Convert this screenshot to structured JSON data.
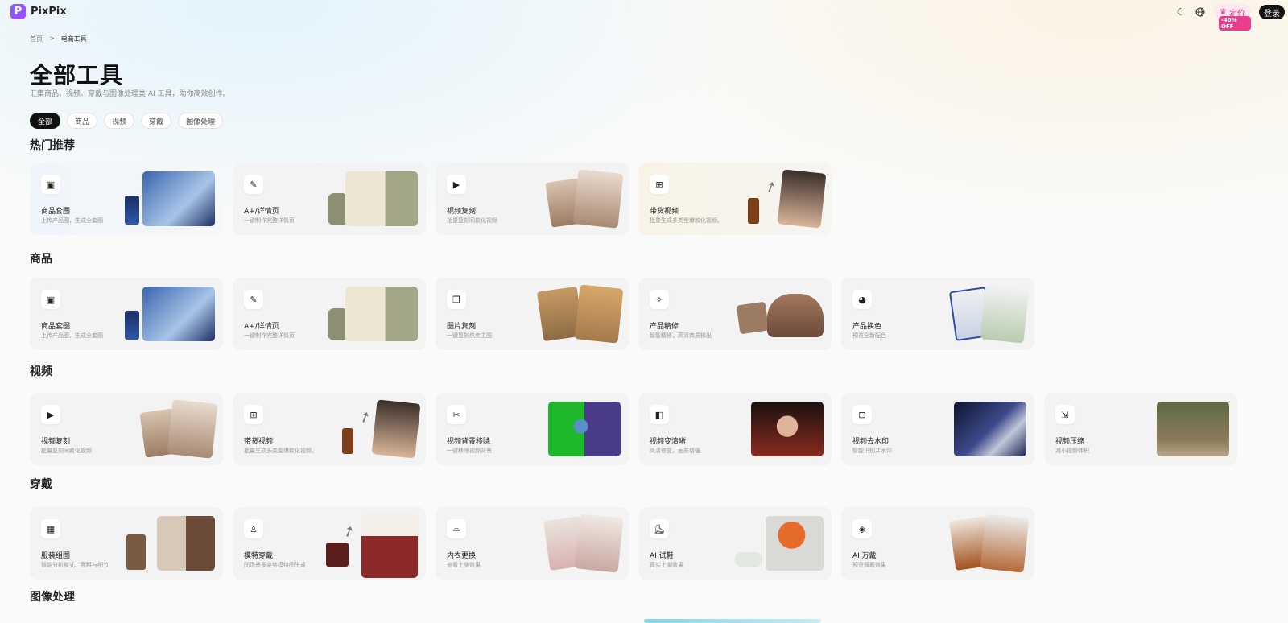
{
  "app": {
    "name": "PixPix",
    "logo_letter": "P"
  },
  "topbar": {
    "theme_icon": "☾",
    "lang_icon": "🌐",
    "pricing_label": "定价",
    "pricing_badge": "-40% OFF",
    "login_label": "登录"
  },
  "breadcrumb": {
    "home": "首页",
    "separator": ">",
    "current": "电商工具"
  },
  "page": {
    "title": "全部工具",
    "subtitle": "汇集商品、视频、穿戴与图像处理类 AI 工具，助你高效创作。"
  },
  "filters": [
    "全部",
    "商品",
    "视频",
    "穿戴",
    "图像处理"
  ],
  "sections": {
    "hot": {
      "title": "热门推荐",
      "cards": [
        {
          "title": "商品套图",
          "desc": "上传产品图，生成全套图",
          "icon": "image-icon"
        },
        {
          "title": "A+/详情页",
          "desc": "一键制作完整详情页",
          "icon": "page-edit-icon"
        },
        {
          "title": "视频复刻",
          "desc": "批量复刻同款化视频",
          "icon": "video-icon"
        },
        {
          "title": "带货视频",
          "desc": "批量生成多类型爆款化视频。",
          "icon": "video-plus-icon"
        }
      ]
    },
    "product": {
      "title": "商品",
      "cards": [
        {
          "title": "商品套图",
          "desc": "上传产品图，生成全套图",
          "icon": "image-icon"
        },
        {
          "title": "A+/详情页",
          "desc": "一键制作完整详情页",
          "icon": "page-edit-icon"
        },
        {
          "title": "图片复刻",
          "desc": "一键复刻热卖主图",
          "icon": "copy-icon"
        },
        {
          "title": "产品精修",
          "desc": "智能精修，高清商质输出",
          "icon": "wand-icon"
        },
        {
          "title": "产品换色",
          "desc": "预览全新配色",
          "icon": "palette-icon"
        }
      ]
    },
    "video": {
      "title": "视频",
      "cards": [
        {
          "title": "视频复刻",
          "desc": "批量复刻同款化视频",
          "icon": "video-icon"
        },
        {
          "title": "带货视频",
          "desc": "批量生成多类型爆款化视频。",
          "icon": "video-plus-icon"
        },
        {
          "title": "视频背景移除",
          "desc": "一键移除视频背景",
          "icon": "video-cut-icon"
        },
        {
          "title": "视频变清晰",
          "desc": "高清修复，画质增强",
          "icon": "video-hd-icon"
        },
        {
          "title": "视频去水印",
          "desc": "智能识别并水印",
          "icon": "video-erase-icon"
        },
        {
          "title": "视频压缩",
          "desc": "减小视频体积",
          "icon": "video-compress-icon"
        }
      ]
    },
    "wear": {
      "title": "穿戴",
      "cards": [
        {
          "title": "服装组图",
          "desc": "智能分析款式、面料与细节",
          "icon": "grid-icon"
        },
        {
          "title": "模特穿戴",
          "desc": "同场景多姿势模特图生成",
          "icon": "dress-icon"
        },
        {
          "title": "内衣更换",
          "desc": "查看上身效果",
          "icon": "lingerie-icon"
        },
        {
          "title": "AI 试鞋",
          "desc": "真实上脚效果",
          "icon": "shoe-icon"
        },
        {
          "title": "AI 万戴",
          "desc": "预览佩戴效果",
          "icon": "accessory-icon"
        }
      ]
    },
    "image": {
      "title": "图像处理"
    }
  },
  "thumb_colors": {
    "perfume": "#274b8f",
    "ice": "#7fa8d6",
    "bag": "#a8a88c",
    "poster": "#e9e4d2",
    "face": "#c9a98f",
    "amber": "#8a4a21",
    "hand": "#3b2f2a",
    "tan": "#c89a63",
    "case": "#8e6a55",
    "can": "#2c4ea8",
    "mint": "#a8c1a0",
    "green": "#1fb82c",
    "portrait": "#8a2a1e",
    "navy": "#1c2450",
    "forest": "#5e6a45",
    "coat": "#7a5a40",
    "plaid": "#8c2a2a",
    "pink": "#d8b2b0",
    "orange": "#e46b2a",
    "scarf": "#a3511f"
  }
}
